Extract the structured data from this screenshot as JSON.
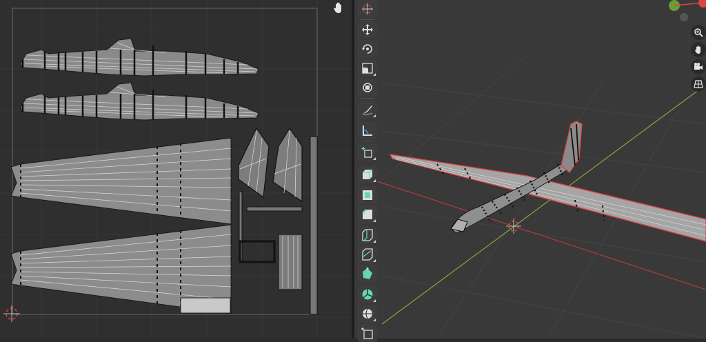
{
  "colors": {
    "uv_bg": "#2f2f2f",
    "viewport_bg": "#393939",
    "active_tool": "#66d4b4",
    "selection_red": "#e04545",
    "x_axis": "#b33b3b",
    "y_axis": "#8aa63a"
  },
  "uv_editor": {
    "icons": [
      "hand-icon",
      "cursor-icon"
    ]
  },
  "toolbar": {
    "tools": [
      {
        "name": "cursor-tool",
        "icon": "cursor-icon"
      },
      {
        "name": "move-tool",
        "icon": "move-icon"
      },
      {
        "name": "rotate-tool",
        "icon": "rotate-icon"
      },
      {
        "name": "scale-tool",
        "icon": "scale-icon"
      },
      {
        "name": "transform-tool",
        "icon": "transform-icon"
      },
      {
        "name": "annotate-tool",
        "icon": "annotate-icon"
      },
      {
        "name": "measure-tool",
        "icon": "measure-icon"
      },
      {
        "name": "add-cube-tool",
        "icon": "add-cube-icon"
      },
      {
        "name": "extrude-tool",
        "icon": "extrude-icon"
      },
      {
        "name": "inset-tool",
        "icon": "inset-icon"
      },
      {
        "name": "bevel-tool",
        "icon": "bevel-icon"
      },
      {
        "name": "loop-cut-tool",
        "icon": "loop-cut-icon"
      },
      {
        "name": "knife-tool",
        "icon": "knife-icon"
      },
      {
        "name": "poly-build-tool",
        "icon": "poly-build-icon"
      },
      {
        "name": "spin-tool",
        "icon": "spin-icon"
      },
      {
        "name": "smooth-tool",
        "icon": "smooth-icon"
      },
      {
        "name": "shrink-tool",
        "icon": "shrink-icon"
      }
    ]
  },
  "viewport": {
    "nav_icons": [
      "zoom-icon",
      "hand-icon",
      "camera-icon",
      "grid-icon"
    ]
  }
}
